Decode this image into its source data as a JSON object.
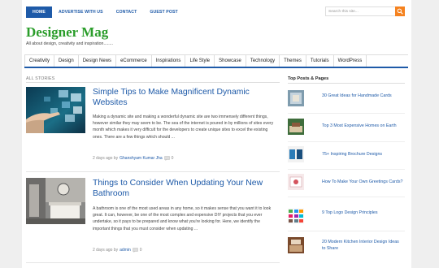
{
  "topnav": {
    "items": [
      "HOME",
      "ADVERTISE WITH US",
      "CONTACT",
      "GUEST POST"
    ]
  },
  "search": {
    "placeholder": "Search this site..."
  },
  "site": {
    "title": "Designer Mag",
    "tagline": "All about design, creativity and inspiration........"
  },
  "categories": [
    "Creativity",
    "Design",
    "Design News",
    "eCommerce",
    "Inspirations",
    "Life Style",
    "Showcase",
    "Technology",
    "Themes",
    "Tutorials",
    "WordPress"
  ],
  "main": {
    "section_label": "ALL STORIES",
    "posts": [
      {
        "title": "Simple Tips to Make Magnificent Dynamic Websites",
        "excerpt": "Making a dynamic site and making a wonderful dynamic site are two immensely different things, however similar they may seem to be. The sea of the internet is poured in by millions of sites every month which makes it very difficult for the developers to create unique sites to excel the existing ones. There are a few things which should ...",
        "date": "2 days ago by",
        "author": "Ghanshyam Kumar Jha",
        "comments": "0"
      },
      {
        "title": "Things to Consider When Updating Your New Bathroom",
        "excerpt": "A bathroom is one of the most used areas in any home, so it makes sense that you want it to look great. It can, however, be one of the most complex and expensive DIY projects that you ever undertake, so it pays to be prepared and know what you're looking for. Here, we identify the important things that you must consider when updating ...",
        "date": "2 days ago by",
        "author": "admin",
        "comments": "0"
      }
    ]
  },
  "sidebar": {
    "title": "Top Posts & Pages",
    "items": [
      "30 Great Ideas for Handmade Cards",
      "Top 3 Most Expensive Homes on Earth",
      "75+ Inspiring Brochure Designs",
      "How To Make Your Own Greetings Cards?",
      "9 Top Logo Design Principles",
      "20 Modern Kitchen Interior Design Ideas to Share"
    ]
  },
  "colors": {
    "accent": "#1e5aa8",
    "logo": "#2a9d2a",
    "search_button": "#f5821f"
  }
}
